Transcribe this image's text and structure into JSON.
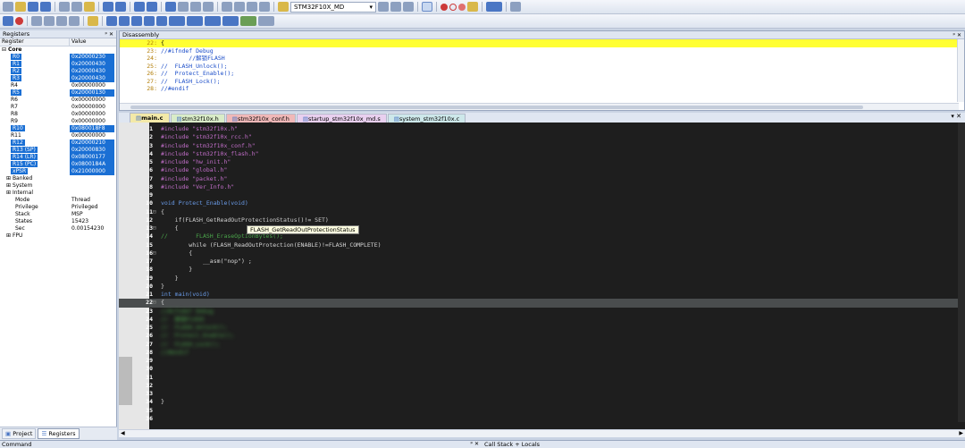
{
  "toolbar": {
    "target_name": "STM32F10X_MD"
  },
  "registers_panel": {
    "title": "Registers",
    "col_register": "Register",
    "col_value": "Value",
    "rows": [
      {
        "name": "Core",
        "value": "",
        "indent": 0,
        "bold": true,
        "sel": false
      },
      {
        "name": "R0",
        "value": "0x20000230",
        "indent": 2,
        "sel": true
      },
      {
        "name": "R1",
        "value": "0x20000430",
        "indent": 2,
        "sel": true
      },
      {
        "name": "R2",
        "value": "0x20000430",
        "indent": 2,
        "sel": true
      },
      {
        "name": "R3",
        "value": "0x20000430",
        "indent": 2,
        "sel": true
      },
      {
        "name": "R4",
        "value": "0x00000000",
        "indent": 2,
        "sel": false
      },
      {
        "name": "R5",
        "value": "0x20000130",
        "indent": 2,
        "sel": true
      },
      {
        "name": "R6",
        "value": "0x00000000",
        "indent": 2,
        "sel": false
      },
      {
        "name": "R7",
        "value": "0x00000000",
        "indent": 2,
        "sel": false
      },
      {
        "name": "R8",
        "value": "0x00000000",
        "indent": 2,
        "sel": false
      },
      {
        "name": "R9",
        "value": "0x00000000",
        "indent": 2,
        "sel": false
      },
      {
        "name": "R10",
        "value": "0x080018F8",
        "indent": 2,
        "sel": true
      },
      {
        "name": "R11",
        "value": "0x00000000",
        "indent": 2,
        "sel": false
      },
      {
        "name": "R12",
        "value": "0x20000210",
        "indent": 2,
        "sel": true
      },
      {
        "name": "R13 (SP)",
        "value": "0x20000830",
        "indent": 2,
        "sel": true
      },
      {
        "name": "R14 (LR)",
        "value": "0x08000177",
        "indent": 2,
        "sel": true
      },
      {
        "name": "R15 (PC)",
        "value": "0x0800184A",
        "indent": 2,
        "sel": true
      },
      {
        "name": "xPSR",
        "value": "0x21000000",
        "indent": 2,
        "sel": true
      },
      {
        "name": "Banked",
        "value": "",
        "indent": 1,
        "sel": false
      },
      {
        "name": "System",
        "value": "",
        "indent": 1,
        "sel": false
      },
      {
        "name": "Internal",
        "value": "",
        "indent": 1,
        "sel": false
      },
      {
        "name": "Mode",
        "value": "Thread",
        "indent": 3,
        "sel": false
      },
      {
        "name": "Privilege",
        "value": "Privileged",
        "indent": 3,
        "sel": false
      },
      {
        "name": "Stack",
        "value": "MSP",
        "indent": 3,
        "sel": false
      },
      {
        "name": "States",
        "value": "15423",
        "indent": 3,
        "sel": false
      },
      {
        "name": "Sec",
        "value": "0.00154230",
        "indent": 3,
        "sel": false
      },
      {
        "name": "FPU",
        "value": "",
        "indent": 1,
        "sel": false
      }
    ],
    "bottom_tabs": [
      "Project",
      "Registers"
    ]
  },
  "disassembly": {
    "title": "Disassembly",
    "lines": [
      {
        "num": "22:",
        "text": "{",
        "highlight": true
      },
      {
        "num": "23:",
        "text": "//#ifndef Debug",
        "highlight": false
      },
      {
        "num": "24:",
        "text": "        //解锁FLASH",
        "highlight": false
      },
      {
        "num": "25:",
        "text": "//  FLASH_Unlock();",
        "highlight": false
      },
      {
        "num": "26:",
        "text": "//  Protect_Enable();",
        "highlight": false
      },
      {
        "num": "27:",
        "text": "//  FLASH_Lock();",
        "highlight": false
      },
      {
        "num": "28:",
        "text": "//#endif",
        "highlight": false
      }
    ]
  },
  "editor": {
    "tabs": [
      {
        "label": "main.c",
        "active": true,
        "color": "#f3e9a8"
      },
      {
        "label": "stm32f10x.h",
        "active": false,
        "color": "#d9ecc8"
      },
      {
        "label": "stm32f10x_conf.h",
        "active": false,
        "color": "#f0b8b8"
      },
      {
        "label": "startup_stm32f10x_md.s",
        "active": false,
        "color": "#e9d0ef"
      },
      {
        "label": "system_stm32f10x.c",
        "active": false,
        "color": "#cde8ea"
      }
    ],
    "tooltip": "FLASH_GetReadOutProtectionStatus",
    "lines": [
      {
        "n": "1",
        "t": "#include \"stm32f10x.h\""
      },
      {
        "n": "2",
        "t": "#include \"stm32f10x_rcc.h\""
      },
      {
        "n": "3",
        "t": "#include \"stm32f10x_conf.h\""
      },
      {
        "n": "4",
        "t": "#include \"stm32f10x_flash.h\""
      },
      {
        "n": "5",
        "t": "#include \"hw_init.h\""
      },
      {
        "n": "6",
        "t": "#include \"global.h\""
      },
      {
        "n": "7",
        "t": "#include \"packet.h\""
      },
      {
        "n": "8",
        "t": "#include \"Ver_Info.h\""
      },
      {
        "n": "9",
        "t": ""
      },
      {
        "n": "10",
        "t": "void Protect_Enable(void)"
      },
      {
        "n": "11",
        "t": "{"
      },
      {
        "n": "12",
        "t": "    if(FLASH_GetReadOutProtectionStatus()!= SET)"
      },
      {
        "n": "13",
        "t": "    {"
      },
      {
        "n": "14",
        "t": "//        FLASH_EraseOptionBytes();"
      },
      {
        "n": "15",
        "t": "        while (FLASH_ReadOutProtection(ENABLE)!=FLASH_COMPLETE)"
      },
      {
        "n": "16",
        "t": "        {"
      },
      {
        "n": "17",
        "t": "            __asm(\"nop\") ;"
      },
      {
        "n": "18",
        "t": "        }"
      },
      {
        "n": "19",
        "t": "    }"
      },
      {
        "n": "20",
        "t": "}"
      },
      {
        "n": "21",
        "t": "int main(void)"
      },
      {
        "n": "22",
        "t": "{"
      },
      {
        "n": "23",
        "t": "//#ifndef Debug"
      },
      {
        "n": "24",
        "t": "//  解锁FLASH"
      },
      {
        "n": "25",
        "t": "//  FLASH_Unlock();"
      },
      {
        "n": "26",
        "t": "//  Protect_Enable();"
      },
      {
        "n": "27",
        "t": "//  FLASH_Lock();"
      },
      {
        "n": "28",
        "t": "//#endif"
      },
      {
        "n": "29",
        "t": ""
      },
      {
        "n": "30",
        "t": ""
      },
      {
        "n": "31",
        "t": ""
      },
      {
        "n": "32",
        "t": ""
      },
      {
        "n": "33",
        "t": ""
      },
      {
        "n": "34",
        "t": "}"
      },
      {
        "n": "35",
        "t": ""
      },
      {
        "n": "36",
        "t": ""
      }
    ]
  },
  "bottom": {
    "command_label": "Command",
    "callstack_label": "Call Stack + Locals"
  }
}
